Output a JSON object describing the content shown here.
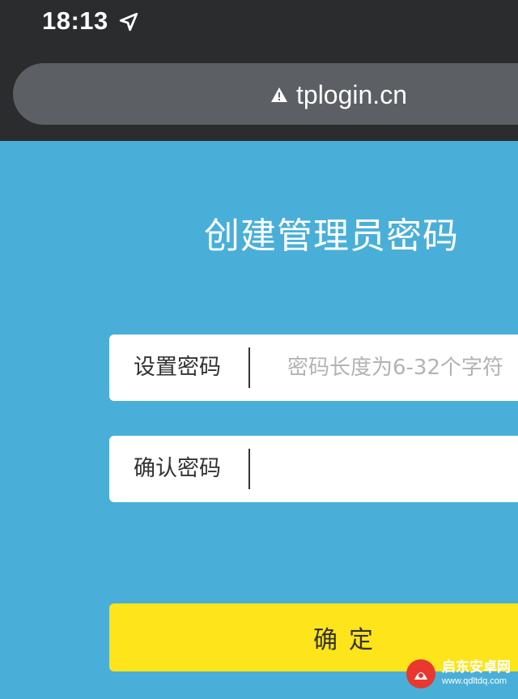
{
  "status_bar": {
    "time": "18:13",
    "location_icon": "location-arrow-icon"
  },
  "browser": {
    "url": "tplogin.cn",
    "security_icon": "warning-triangle-icon"
  },
  "page": {
    "title": "创建管理员密码",
    "fields": [
      {
        "label": "设置密码",
        "value": "",
        "placeholder": "密码长度为6-32个字符"
      },
      {
        "label": "确认密码",
        "value": "",
        "placeholder": ""
      }
    ],
    "submit_label": "确定"
  },
  "watermark": {
    "name": "启东安卓网",
    "url": "www.qdltdq.com"
  },
  "colors": {
    "background": "#49afd9",
    "chrome": "#2b2c2e",
    "url_bar": "#5c5f63",
    "button": "#fde41b"
  }
}
